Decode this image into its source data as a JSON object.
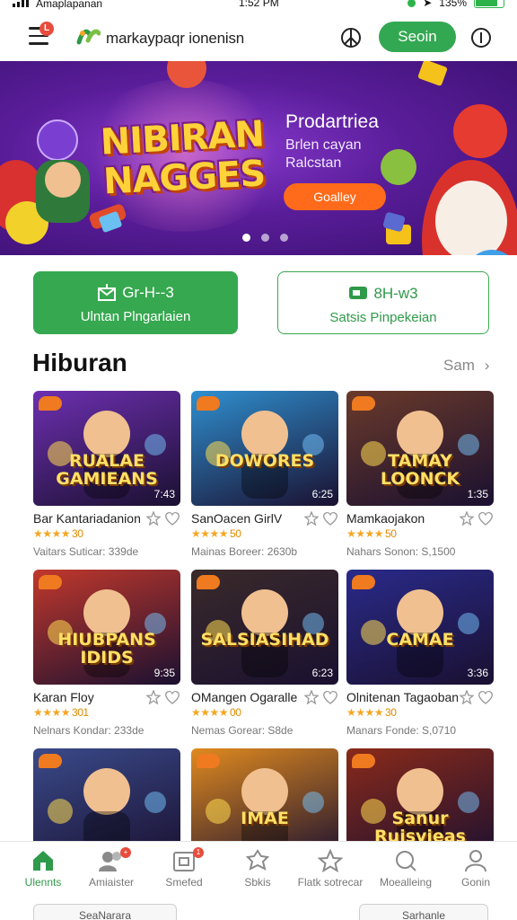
{
  "status_bar": {
    "carrier": "Amaplapanan",
    "time": "1:52 PM",
    "battery": "135%"
  },
  "header": {
    "menu_badge": "L",
    "app_title": "markaypaqr ionenisn",
    "signin_label": "Seoin",
    "icons": [
      "menu-icon",
      "logo-icon",
      "peace-icon",
      "info-icon"
    ]
  },
  "banner": {
    "title": "NIBIRAN NAGGES",
    "headline": "Prodartriea",
    "subline1": "Brlen cayan",
    "subline2": "Ralcstan",
    "button": "Goalley",
    "slide_count": 3,
    "active_slide": 1
  },
  "actions": {
    "primary": {
      "top": "Gr-H--3",
      "bottom": "Ulntan Plngarlaien"
    },
    "secondary": {
      "top": "8H-w3",
      "bottom": "Satsis Pinpekeian"
    }
  },
  "section": {
    "title": "Hiburan",
    "see_all": "Sam"
  },
  "cards": [
    {
      "art": "RUALAE GAMIEANS",
      "duration": "7:43",
      "name": "Bar Kantariadanion",
      "rating": "30",
      "meta": "Vaitars Suticar: 339de",
      "bg": "#6d2fb0"
    },
    {
      "art": "DOWORES",
      "duration": "6:25",
      "name": "SanOacen GirlV",
      "rating": "50",
      "meta": "Mainas Boreer: 2630b",
      "bg": "#2f8fcf"
    },
    {
      "art": "TAMAY LOONCK",
      "duration": "1:35",
      "name": "Mamkaojakon",
      "rating": "50",
      "meta": "Nahars Sonon: S,1500",
      "bg": "#6a3a2a"
    },
    {
      "art": "HIUBPANS IDIDS",
      "duration": "9:35",
      "name": "Karan Floy",
      "rating": "301",
      "meta": "Nelnars Kondar: 233de",
      "bg": "#c2382c"
    },
    {
      "art": "SALSIASIHAD",
      "duration": "6:23",
      "name": "OMangen Ogaralle",
      "rating": "00",
      "meta": "Nemas Gorear: S8de",
      "bg": "#3a2a2a"
    },
    {
      "art": "CAMAE",
      "duration": "3:36",
      "name": "Olnitenan Tagaoban",
      "rating": "30",
      "meta": "Manars Fonde: S,0710",
      "bg": "#2a2a8a"
    },
    {
      "art": "",
      "duration": "",
      "name": "",
      "rating": "",
      "meta": "",
      "bg": "#3a4a8a"
    },
    {
      "art": "IMAE",
      "duration": "",
      "name": "",
      "rating": "",
      "meta": "",
      "bg": "#e08a1f"
    },
    {
      "art": "Sanur Ruisvieas",
      "duration": "",
      "name": "",
      "rating": "",
      "meta": "",
      "bg": "#8a2a1a"
    }
  ],
  "bottom_nav": [
    {
      "label": "Ulennts",
      "icon": "home-icon",
      "active": true
    },
    {
      "label": "Amiaister",
      "icon": "users-icon",
      "badge": "+"
    },
    {
      "label": "Smefed",
      "icon": "box-icon",
      "badge": "1"
    },
    {
      "label": "Sbkis",
      "icon": "badge-icon"
    },
    {
      "label": "Flatk sotrecar",
      "icon": "star-icon"
    },
    {
      "label": "Moealleing",
      "icon": "search-icon"
    },
    {
      "label": "Gonin",
      "icon": "profile-icon"
    }
  ],
  "peek": {
    "left": "SeaNarara",
    "right": "Sarhanle"
  },
  "colors": {
    "accent": "#33a852",
    "banner_button": "#ff6b1a",
    "star": "#f5a623"
  }
}
